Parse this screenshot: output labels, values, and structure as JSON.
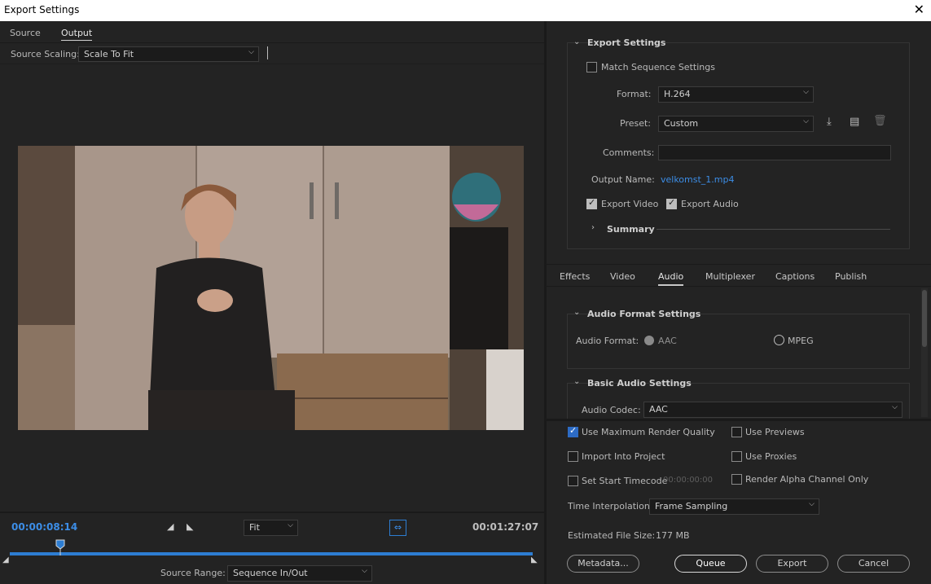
{
  "window": {
    "title": "Export Settings"
  },
  "left": {
    "tabs": [
      "Source",
      "Output"
    ],
    "active_tab": "Output",
    "source_scaling_label": "Source Scaling:",
    "source_scaling_value": "Scale To Fit",
    "current_time": "00:00:08:14",
    "fit_value": "Fit",
    "end_time": "00:01:27:07",
    "playhead_fraction": 0.097,
    "source_range_label": "Source Range:",
    "source_range_value": "Sequence In/Out"
  },
  "export_settings": {
    "header": "Export Settings",
    "match_sequence": "Match Sequence Settings",
    "format_label": "Format:",
    "format_value": "H.264",
    "preset_label": "Preset:",
    "preset_value": "Custom",
    "comments_label": "Comments:",
    "output_name_label": "Output Name:",
    "output_name_value": "velkomst_1.mp4",
    "export_video": "Export Video",
    "export_audio": "Export Audio",
    "summary": "Summary"
  },
  "settings_tabs": [
    "Effects",
    "Video",
    "Audio",
    "Multiplexer",
    "Captions",
    "Publish"
  ],
  "active_settings_tab": "Audio",
  "audio": {
    "format_header": "Audio Format Settings",
    "format_label": "Audio Format:",
    "option_aac": "AAC",
    "option_mpeg": "MPEG",
    "basic_header": "Basic Audio Settings",
    "codec_label": "Audio Codec:",
    "codec_value": "AAC"
  },
  "options": {
    "max_render": "Use Maximum Render Quality",
    "use_previews": "Use Previews",
    "import_project": "Import Into Project",
    "use_proxies": "Use Proxies",
    "set_start_tc": "Set Start Timecode",
    "start_tc_value": "00:00:00:00",
    "render_alpha": "Render Alpha Channel Only",
    "time_interp_label": "Time Interpolation:",
    "time_interp_value": "Frame Sampling",
    "file_size_label": "Estimated File Size:",
    "file_size_value": "177 MB"
  },
  "buttons": {
    "metadata": "Metadata...",
    "queue": "Queue",
    "export": "Export",
    "cancel": "Cancel"
  },
  "colors": {
    "accent_blue": "#3c8de6",
    "timeline_blue": "#2d7dd2"
  }
}
